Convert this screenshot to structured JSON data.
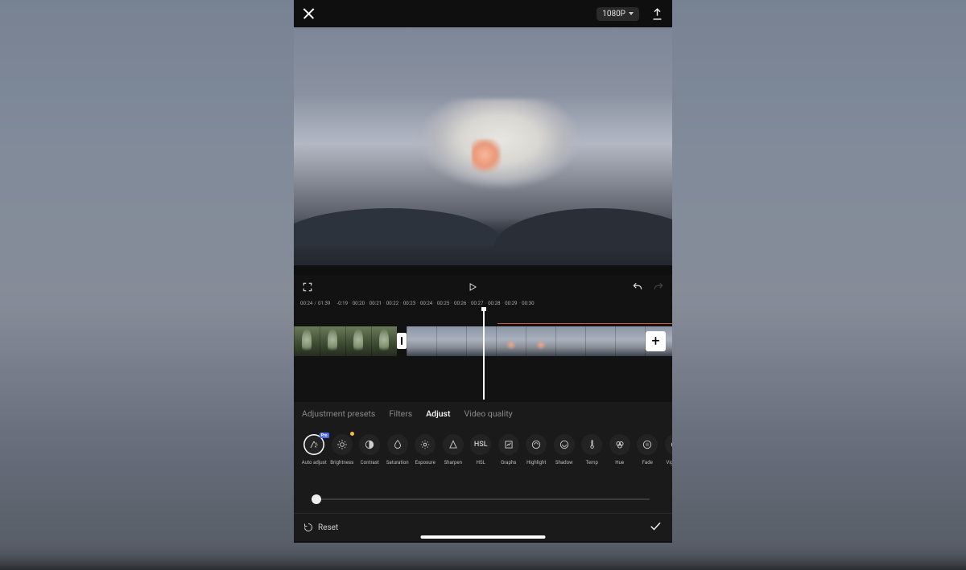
{
  "header": {
    "resolution": "1080P"
  },
  "playback": {
    "current": "00:24",
    "total": "01:39"
  },
  "ruler": {
    "offset": "-0:19",
    "marks": [
      "00:20",
      "00:21",
      "00:22",
      "00:23",
      "00:24",
      "00:25",
      "00:26",
      "00:27",
      "00:28",
      "00:29",
      "00:30"
    ]
  },
  "tabs": [
    {
      "id": "presets",
      "label": "Adjustment presets",
      "active": false
    },
    {
      "id": "filters",
      "label": "Filters",
      "active": false
    },
    {
      "id": "adjust",
      "label": "Adjust",
      "active": true
    },
    {
      "id": "quality",
      "label": "Video quality",
      "active": false
    }
  ],
  "tools": [
    {
      "id": "auto",
      "label": "Auto adjust",
      "pro": true
    },
    {
      "id": "brightness",
      "label": "Brightness",
      "dot": true
    },
    {
      "id": "contrast",
      "label": "Contrast"
    },
    {
      "id": "saturation",
      "label": "Saturation"
    },
    {
      "id": "exposure",
      "label": "Exposure"
    },
    {
      "id": "sharpen",
      "label": "Sharpen"
    },
    {
      "id": "hsl",
      "label": "HSL"
    },
    {
      "id": "graphs",
      "label": "Graphs"
    },
    {
      "id": "highlight",
      "label": "Highlight"
    },
    {
      "id": "shadow",
      "label": "Shadow"
    },
    {
      "id": "temp",
      "label": "Temp"
    },
    {
      "id": "hue",
      "label": "Hue"
    },
    {
      "id": "fade",
      "label": "Fade"
    },
    {
      "id": "vignette",
      "label": "Vignette"
    }
  ],
  "selected_tool": "auto",
  "hsl_text": "HSL",
  "pro_text": "Pro",
  "slider": {
    "position_pct": 0
  },
  "bottom": {
    "reset_label": "Reset"
  }
}
